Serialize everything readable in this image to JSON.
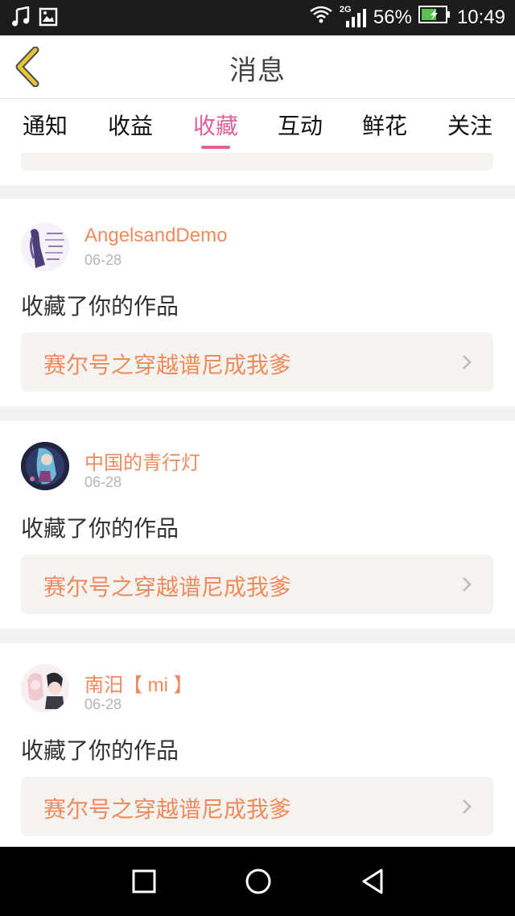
{
  "statusbar": {
    "battery_percent": "56%",
    "time": "10:49",
    "network": "2G",
    "icons": [
      "music-icon",
      "image-icon",
      "wifi-icon",
      "signal-icon",
      "battery-icon"
    ]
  },
  "header": {
    "title": "消息",
    "back_icon": "chevron-left-icon"
  },
  "tabs": [
    "通知",
    "收益",
    "收藏",
    "互动",
    "鲜花",
    "关注"
  ],
  "active_tab": "收藏",
  "messages": [
    {
      "username": "AngelsandDemo",
      "date": "06-28",
      "action": "收藏了你的作品",
      "work_title": "赛尔号之穿越谱尼成我爹"
    },
    {
      "username": "中国的青行灯",
      "date": "06-28",
      "action": "收藏了你的作品",
      "work_title": "赛尔号之穿越谱尼成我爹"
    },
    {
      "username": "南汨【 mi 】",
      "date": "06-28",
      "action": "收藏了你的作品",
      "work_title": "赛尔号之穿越谱尼成我爹"
    }
  ],
  "navbar": {
    "icons": [
      "square-icon",
      "circle-icon",
      "back-triangle-icon"
    ]
  },
  "colors": {
    "accent": "#e0609a",
    "username": "#f08a5d",
    "work_bg": "#f5f3ef",
    "back_arrow": "#e8c43a"
  }
}
